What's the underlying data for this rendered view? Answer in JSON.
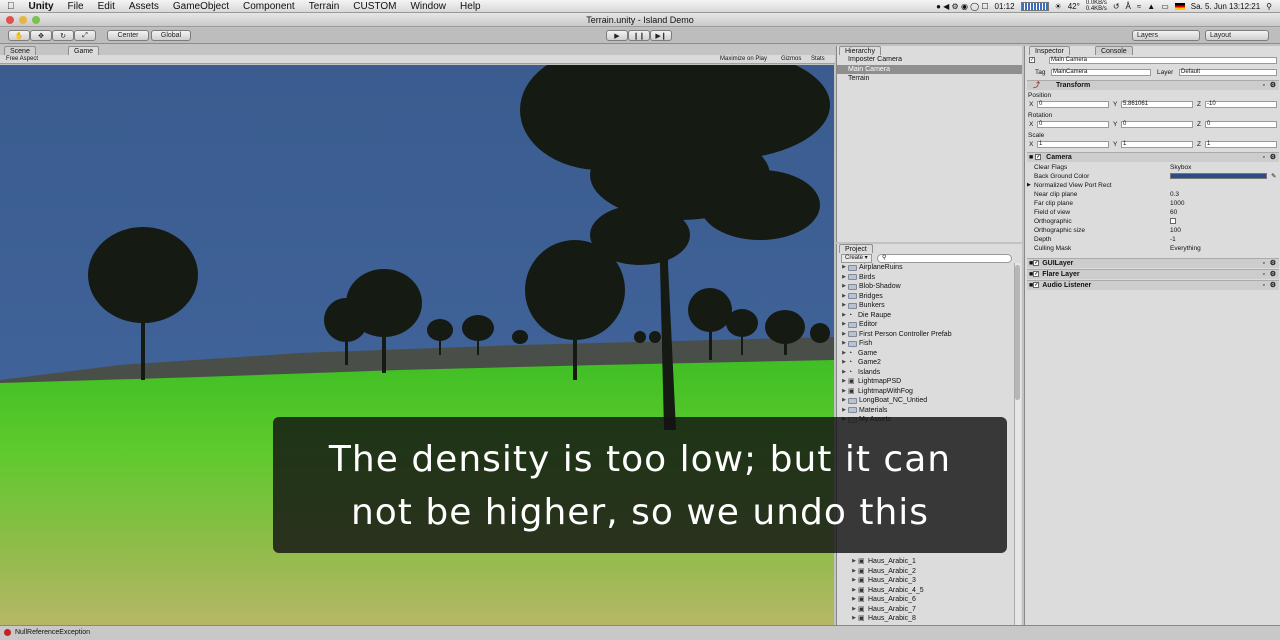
{
  "menubar": {
    "apple": "",
    "items": [
      "Unity",
      "File",
      "Edit",
      "Assets",
      "GameObject",
      "Component",
      "Terrain",
      "CUSTOM",
      "Window",
      "Help"
    ],
    "clock_small": "01:12",
    "temperature": "42°",
    "net_up": "0.0KB/s",
    "net_down": "0.4KB/s",
    "datetime": "Sa. 5. Jun  13:12:21"
  },
  "window": {
    "title": "Terrain.unity - Island Demo"
  },
  "toolbar": {
    "pivot": "Center",
    "space": "Global",
    "layers": "Layers",
    "layout": "Layout"
  },
  "scene_tabs": {
    "scene": "Scene",
    "game": "Game"
  },
  "game_bar": {
    "aspect": "Free Aspect",
    "maximize": "Maximize on Play",
    "gizmos": "Gizmos",
    "stats": "Stats"
  },
  "hierarchy": {
    "tab": "Hierarchy",
    "items": [
      "Imposter Camera",
      "Main Camera",
      "Terrain"
    ]
  },
  "project": {
    "tab": "Project",
    "create": "Create",
    "items": [
      {
        "label": "AirplaneRuins",
        "kind": "folder"
      },
      {
        "label": "Birds",
        "kind": "folder"
      },
      {
        "label": "Blob-Shadow",
        "kind": "folder"
      },
      {
        "label": "Bridges",
        "kind": "folder"
      },
      {
        "label": "Bunkers",
        "kind": "folder"
      },
      {
        "label": "Die Raupe",
        "kind": "scene"
      },
      {
        "label": "Editor",
        "kind": "folder"
      },
      {
        "label": "First Person Controller Prefab",
        "kind": "folder"
      },
      {
        "label": "Fish",
        "kind": "folder"
      },
      {
        "label": "Game",
        "kind": "scene"
      },
      {
        "label": "Game2",
        "kind": "scene"
      },
      {
        "label": "Islands",
        "kind": "scene"
      },
      {
        "label": "LightmapPSD",
        "kind": "asset"
      },
      {
        "label": "LightmapWithFog",
        "kind": "asset"
      },
      {
        "label": "LongBoat_NC_Untied",
        "kind": "folder"
      },
      {
        "label": "Materials",
        "kind": "folder"
      },
      {
        "label": "My Assets",
        "kind": "folder"
      }
    ],
    "lower_items": [
      "Haus_Arabic_1",
      "Haus_Arabic_2",
      "Haus_Arabic_3",
      "Haus_Arabic_4_5",
      "Haus_Arabic_6",
      "Haus_Arabic_7",
      "Haus_Arabic_8"
    ]
  },
  "inspector": {
    "tab": "Inspector",
    "console_tab": "Console",
    "object_name": "Main Camera",
    "tag_label": "Tag",
    "tag_value": "MainCamera",
    "layer_label": "Layer",
    "layer_value": "Default",
    "transform": {
      "title": "Transform",
      "position_label": "Position",
      "position": {
        "x": "0",
        "y": "5.861061",
        "z": "-10"
      },
      "rotation_label": "Rotation",
      "rotation": {
        "x": "0",
        "y": "0",
        "z": "0"
      },
      "scale_label": "Scale",
      "scale": {
        "x": "1",
        "y": "1",
        "z": "1"
      }
    },
    "camera": {
      "title": "Camera",
      "props": [
        {
          "label": "Clear Flags",
          "value": "Skybox"
        },
        {
          "label": "Back Ground Color",
          "value": ""
        },
        {
          "label": "Normalized View Port Rect",
          "value": ""
        },
        {
          "label": "Near clip plane",
          "value": "0.3"
        },
        {
          "label": "Far clip plane",
          "value": "1000"
        },
        {
          "label": "Field of view",
          "value": "60"
        },
        {
          "label": "Orthographic",
          "value": ""
        },
        {
          "label": "Orthographic size",
          "value": "100"
        },
        {
          "label": "Depth",
          "value": "-1"
        },
        {
          "label": "Culling Mask",
          "value": "Everything"
        }
      ]
    },
    "components": [
      "GUILayer",
      "Flare Layer",
      "Audio Listener"
    ]
  },
  "status": {
    "message": "NullReferenceException"
  },
  "subtitle": {
    "line1": "The density is too low; but it can",
    "line2": "not be higher, so we undo this"
  },
  "colors": {
    "sky": "#3a5f93",
    "grass_far": "#4fc12d",
    "grass_near": "#a8b85a",
    "hills": "#4a4e48",
    "selection": "#8f8f8f"
  }
}
